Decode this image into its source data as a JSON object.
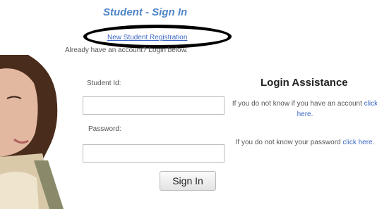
{
  "page": {
    "title": "Student - Sign In",
    "registration_link": "New Student Registration",
    "already_text": "Already have an account? Login below."
  },
  "form": {
    "student_id_label": "Student Id:",
    "student_id_value": "",
    "password_label": "Password:",
    "password_value": "",
    "sign_in_label": "Sign In"
  },
  "assistance": {
    "title": "Login Assistance",
    "account_text": "If you do not know if you have an account",
    "account_link": "click here.",
    "password_text": "If you do not know your password",
    "password_link": "click here."
  }
}
